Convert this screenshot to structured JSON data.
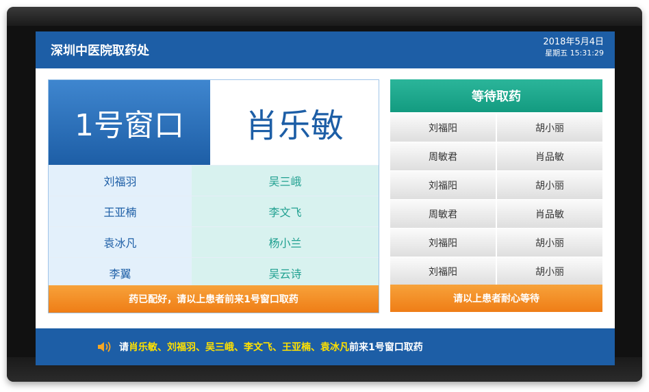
{
  "header": {
    "title": "深圳中医院取药处",
    "date": "2018年5月4日",
    "weekday_time": "星期五 15:31:29"
  },
  "window": {
    "label": "1号窗口",
    "current_patient": "肖乐敏"
  },
  "ready_patients": {
    "rows": [
      [
        "刘福羽",
        "吴三峨"
      ],
      [
        "王亚楠",
        "李文飞"
      ],
      [
        "袁冰凡",
        "杨小兰"
      ],
      [
        "李翼",
        "吴云诗"
      ]
    ],
    "footer": "药已配好，请以上患者前来1号窗口取药"
  },
  "waiting": {
    "title": "等待取药",
    "rows": [
      [
        "刘福阳",
        "胡小丽"
      ],
      [
        "周敏君",
        "肖品敏"
      ],
      [
        "刘福阳",
        "胡小丽"
      ],
      [
        "周敏君",
        "肖品敏"
      ],
      [
        "刘福阳",
        "胡小丽"
      ],
      [
        "刘福阳",
        "胡小丽"
      ]
    ],
    "footer": "请以上患者耐心等待"
  },
  "announcement": {
    "prefix": "请",
    "names": "肖乐敏、刘福羽、吴三峨、李文飞、王亚楠、袁冰凡",
    "suffix": "前来1号窗口取药",
    "icon": "speaker-icon"
  },
  "colors": {
    "primary_blue": "#1d5ea6",
    "teal": "#139b80",
    "orange": "#ef7d16",
    "highlight_yellow": "#ffe100"
  }
}
